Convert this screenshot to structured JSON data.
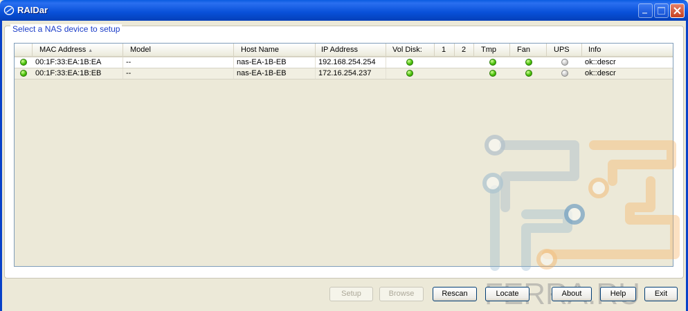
{
  "window": {
    "title": "RAIDar",
    "icon": "raidar-app-icon",
    "controls": [
      "minimize-icon",
      "maximize-icon",
      "close-icon"
    ]
  },
  "group": {
    "label": "Select a NAS device to setup"
  },
  "table": {
    "columns": {
      "mac": "MAC Address",
      "model": "Model",
      "host": "Host Name",
      "ip": "IP Address",
      "vol": "Vol",
      "disk": "Disk:",
      "d1": "1",
      "d2": "2",
      "tmp": "Tmp",
      "fan": "Fan",
      "ups": "UPS",
      "info": "Info"
    },
    "rows": [
      {
        "status": "green",
        "mac": "00:1F:33:EA:1B:EA",
        "model": "--",
        "host": "nas-EA-1B-EB",
        "ip": "192.168.254.254",
        "vol": "green",
        "tmp": "green",
        "fan": "green",
        "ups": "gray",
        "info": "ok::descr"
      },
      {
        "status": "green",
        "mac": "00:1F:33:EA:1B:EB",
        "model": "--",
        "host": "nas-EA-1B-EB",
        "ip": "172.16.254.237",
        "vol": "green",
        "tmp": "green",
        "fan": "green",
        "ups": "gray",
        "info": "ok::descr"
      }
    ]
  },
  "buttons": {
    "setup": "Setup",
    "browse": "Browse",
    "rescan": "Rescan",
    "locate": "Locate",
    "about": "About",
    "help": "Help",
    "exit": "Exit"
  },
  "watermark": {
    "text": "FERRA.RU"
  },
  "colors": {
    "titlebar": "#0a5ce0",
    "led_green": "#4bc20c",
    "led_gray": "#c8c8c8",
    "accent": "#1a3cc8"
  }
}
